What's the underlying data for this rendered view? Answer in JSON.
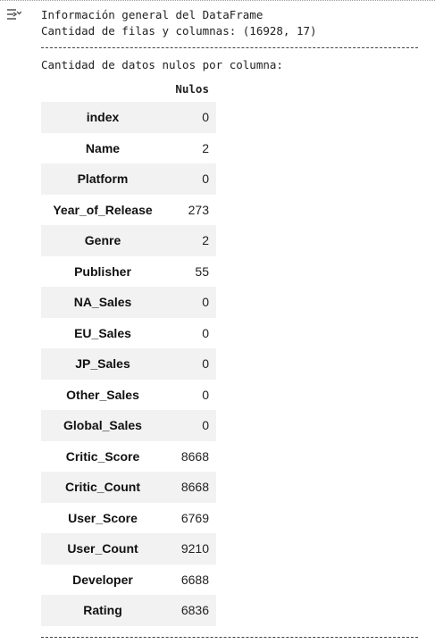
{
  "output": {
    "line1": "Información general del DataFrame",
    "line2": "Cantidad de filas y columnas: (16928, 17)",
    "line3": "Cantidad de datos nulos por columna:"
  },
  "table": {
    "column_header": "Nulos",
    "rows": [
      {
        "label": "index",
        "value": "0"
      },
      {
        "label": "Name",
        "value": "2"
      },
      {
        "label": "Platform",
        "value": "0"
      },
      {
        "label": "Year_of_Release",
        "value": "273"
      },
      {
        "label": "Genre",
        "value": "2"
      },
      {
        "label": "Publisher",
        "value": "55"
      },
      {
        "label": "NA_Sales",
        "value": "0"
      },
      {
        "label": "EU_Sales",
        "value": "0"
      },
      {
        "label": "JP_Sales",
        "value": "0"
      },
      {
        "label": "Other_Sales",
        "value": "0"
      },
      {
        "label": "Global_Sales",
        "value": "0"
      },
      {
        "label": "Critic_Score",
        "value": "8668"
      },
      {
        "label": "Critic_Count",
        "value": "8668"
      },
      {
        "label": "User_Score",
        "value": "6769"
      },
      {
        "label": "User_Count",
        "value": "9210"
      },
      {
        "label": "Developer",
        "value": "6688"
      },
      {
        "label": "Rating",
        "value": "6836"
      }
    ]
  },
  "icons": {
    "output_toggle": "output-menu-icon"
  }
}
